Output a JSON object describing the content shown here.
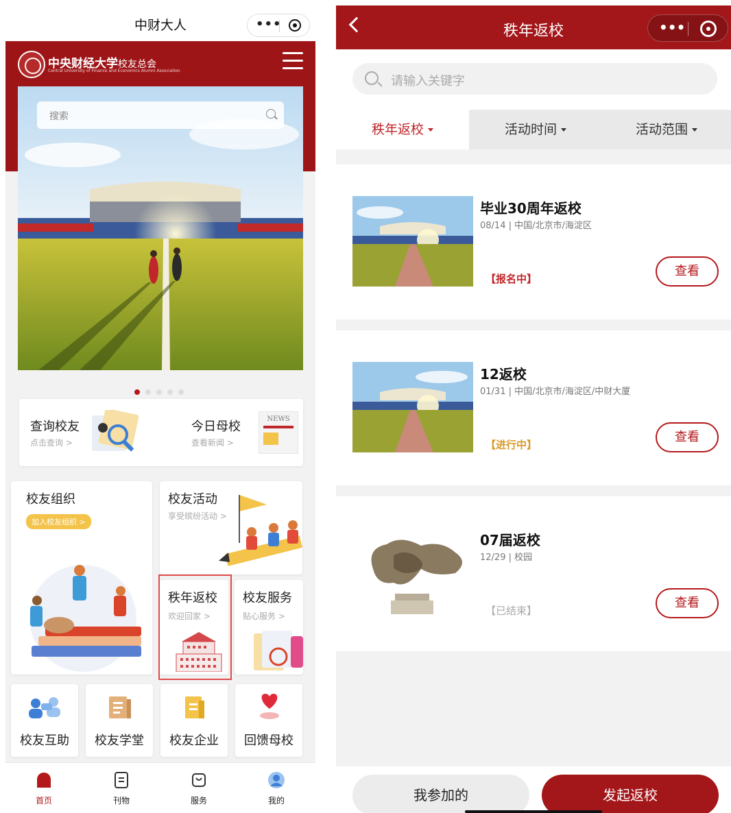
{
  "left": {
    "mini_program_title": "中财大人",
    "logo": {
      "cn": "中央财经大学",
      "cn_suffix": "校友总会",
      "en": "Central University of Finance and Economics Alumni Association"
    },
    "search_placeholder": "搜索",
    "carousel": {
      "count": 5,
      "active": 1
    },
    "quick": [
      {
        "title": "查询校友",
        "sub": "点击查询 >"
      },
      {
        "title": "今日母校",
        "sub": "查看新闻 >",
        "badge": "NEWS"
      }
    ],
    "tiles": {
      "org": {
        "title": "校友组织",
        "pill": "加入校友组织 >"
      },
      "activity": {
        "title": "校友活动",
        "sub": "享受缤纷活动 >"
      },
      "return": {
        "title": "秩年返校",
        "sub": "欢迎回家 >"
      },
      "service": {
        "title": "校友服务",
        "sub": "贴心服务 >"
      }
    },
    "grid": [
      "校友互助",
      "校友学堂",
      "校友企业",
      "回馈母校"
    ],
    "tabs": [
      "首页",
      "刊物",
      "服务",
      "我的"
    ],
    "colors": {
      "brand_red": "#9e1518",
      "pill_yellow": "#f3c34a"
    }
  },
  "right": {
    "title": "秩年返校",
    "search_placeholder": "请输入关键字",
    "filters": [
      "秩年返校",
      "活动时间",
      "活动范围"
    ],
    "events": [
      {
        "name": "毕业30周年返校",
        "meta": "08/14 | 中国/北京市/海淀区",
        "status": "【报名中】",
        "status_color": "#c0272b",
        "button": "查看"
      },
      {
        "name": "12返校",
        "meta": "01/31 | 中国/北京市/海淀区/中财大厦",
        "status": "【进行中】",
        "status_color": "#d89a2a",
        "button": "查看"
      },
      {
        "name": "07届返校",
        "meta": "12/29 | 校园",
        "status": "【已结束】",
        "status_color": "#aaaaaa",
        "button": "查看"
      }
    ],
    "bottom": {
      "mine": "我参加的",
      "launch": "发起返校"
    }
  }
}
